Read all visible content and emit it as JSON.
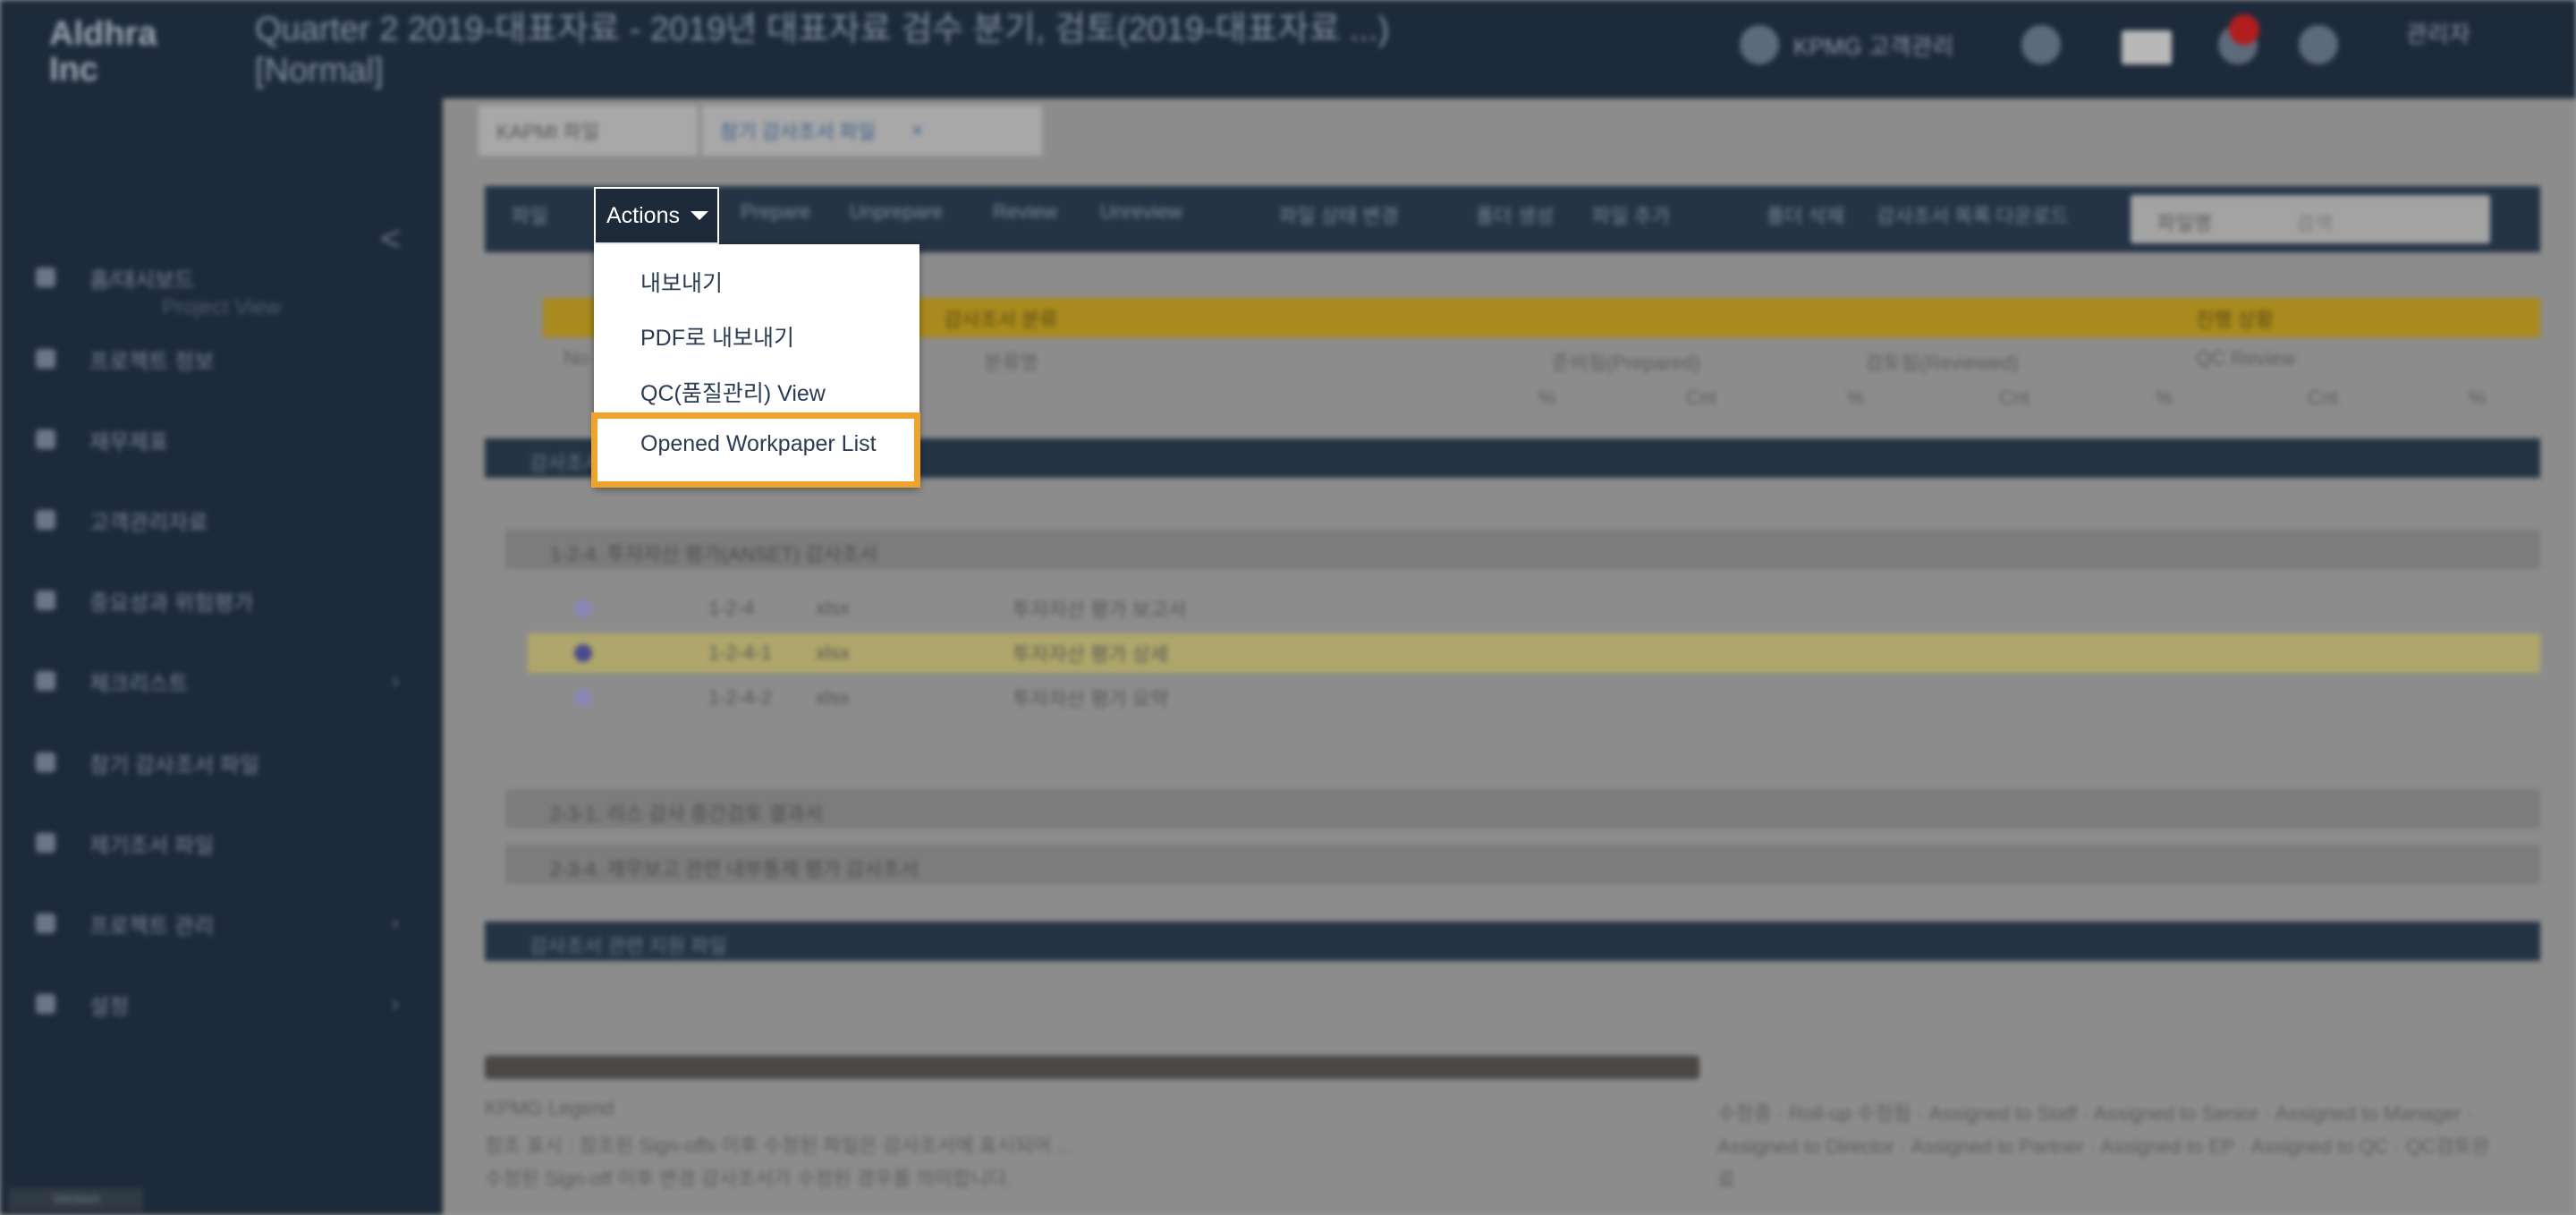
{
  "header": {
    "logo": "Aldhra\nInc",
    "project_title": "Quarter 2 2019-대표자료 - 2019년 대표자료 검수 분기, 검토(2019-대표자료 ...)\n[Normal]",
    "user_label": "KPMG 고객관리",
    "user_name": "관리자"
  },
  "sidebar": {
    "header": "Project View",
    "items": [
      {
        "label": "홈/대시보드",
        "icon": "home-icon",
        "has_chevron": false
      },
      {
        "label": "프로젝트 정보",
        "icon": "info-icon",
        "has_chevron": false
      },
      {
        "label": "재무제표",
        "icon": "document-icon",
        "has_chevron": false
      },
      {
        "label": "고객관리자료",
        "icon": "folder-icon",
        "has_chevron": false
      },
      {
        "label": "중요성과 위험평가",
        "icon": "chart-icon",
        "has_chevron": false
      },
      {
        "label": "체크리스트",
        "icon": "list-icon",
        "has_chevron": true
      },
      {
        "label": "참기 감사조서 파일",
        "icon": "file-icon",
        "has_chevron": false
      },
      {
        "label": "제기조서 파일",
        "icon": "file-icon",
        "has_chevron": false
      },
      {
        "label": "프로젝트 관리",
        "icon": "gear-icon",
        "has_chevron": true
      },
      {
        "label": "설정",
        "icon": "settings-icon",
        "has_chevron": true
      }
    ],
    "bottom_tag": "Version"
  },
  "tabs": [
    {
      "label": "KAPMI 파일"
    },
    {
      "label": "참기 감사조서 파일"
    }
  ],
  "toolbar": {
    "first_label": "파일",
    "actions_label": "Actions",
    "items": [
      "Prepare",
      "Unprepare",
      "Review",
      "Unreview",
      "파일 상태 변경",
      "폴더 생성",
      "파일 추가",
      "폴더 삭제",
      "감사조서 목록 다운로드"
    ],
    "search_select": "파일명",
    "search_placeholder": "검색"
  },
  "actions_menu": {
    "items": [
      "내보내기",
      "PDF로 내보내기",
      "QC(품질관리) View",
      "Opened Workpaper List"
    ],
    "highlighted_index": 3
  },
  "summary_table": {
    "group1": "감사조서 분류",
    "group2": "진행 상황",
    "subhead": [
      "No",
      "분류명",
      "준비됨(Prepared)",
      "검토됨(Reviewed)",
      "QC Review"
    ],
    "units": [
      "%",
      "Cnt",
      "%",
      "Cnt",
      "%",
      "Cnt",
      "%"
    ]
  },
  "sections": [
    {
      "title": "감사조서 파일 목록"
    },
    {
      "title": "감사조서 관련 지원 파일"
    }
  ],
  "folders": [
    {
      "title": "1-2-4. 투자자산 평가(ANSET) 감사조서"
    },
    {
      "title": "2-3-1. 리스 감사 중간검토 결과서"
    },
    {
      "title": "2-3-4. 재무보고 관련 내부통제 평가 감사조서"
    }
  ],
  "file_rows": [
    {
      "ref": "1-2-4",
      "ext": "xlsx",
      "name": "투자자산 평가 보고서"
    },
    {
      "ref": "1-2-4-1",
      "ext": "xlsx",
      "name": "투자자산 평가 상세"
    },
    {
      "ref": "1-2-4-2",
      "ext": "xlsx",
      "name": "투자자산 평가 요약"
    }
  ],
  "footer": {
    "legend_title": "KPMG Legend",
    "note1": "참조 표시 : 참조된 Sign-offs 이후 수정된 파일은 감사조서에 표시되어 ...",
    "note2": "수정된 Sign-off 이후 변경 감사조서가 수정된 경우를 의미합니다."
  },
  "legend_items": [
    "수정중",
    "Roll-up 수정됨",
    "Assigned to Staff",
    "Assigned to Senior",
    "Assigned to Manager",
    "Assigned to Director",
    "Assigned to Partner",
    "Assigned to EP",
    "Assigned to QC",
    "QC검토완료"
  ],
  "colors": {
    "topbar": "#1d2a3a",
    "accent_highlight": "#f0a32b",
    "menu_text": "#2a3b52"
  }
}
